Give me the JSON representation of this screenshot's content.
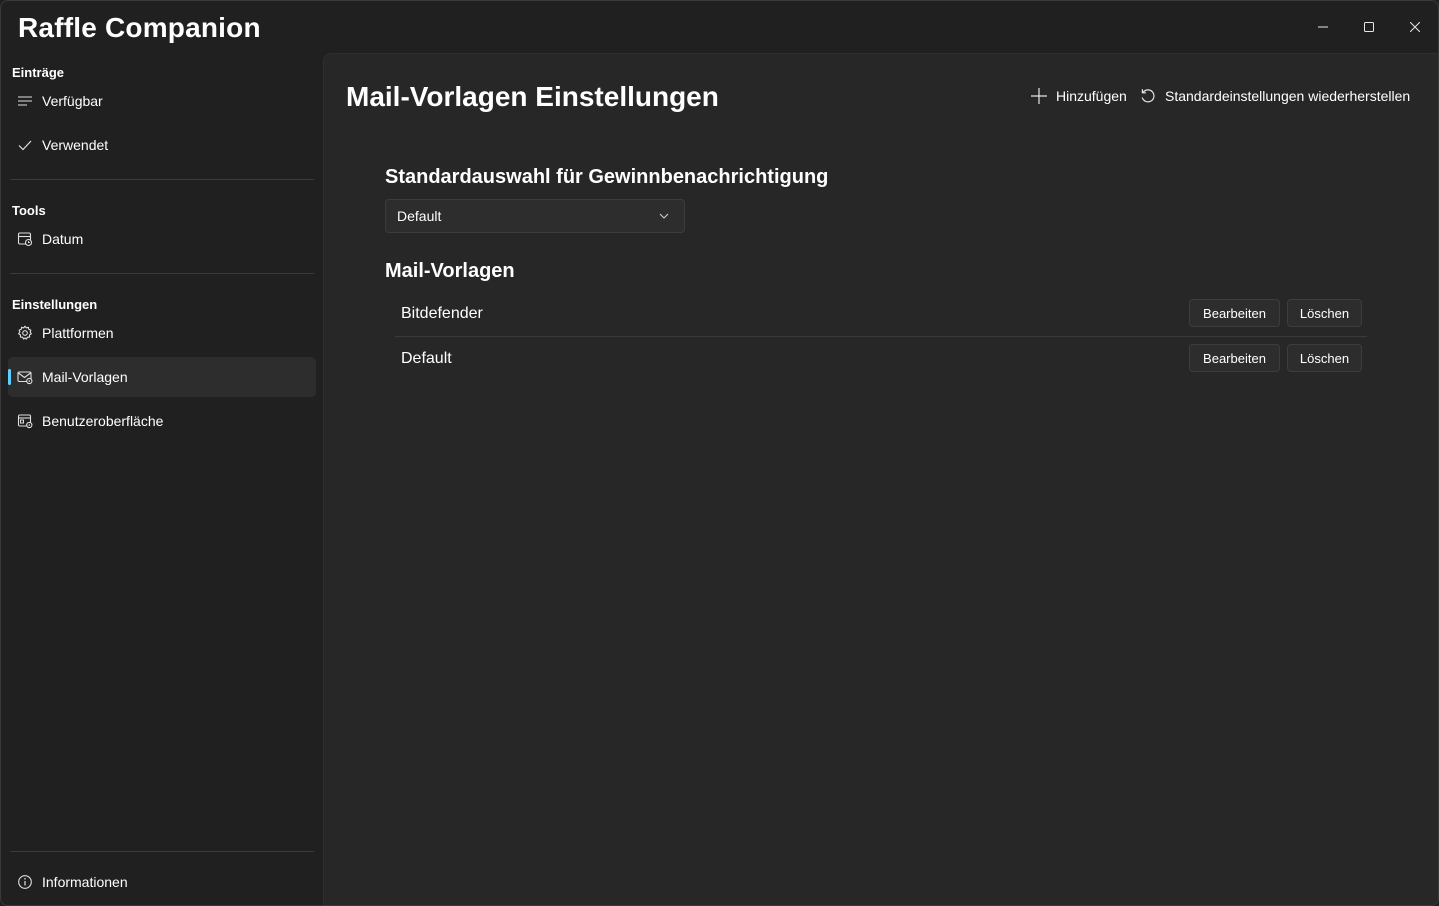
{
  "app": {
    "title": "Raffle Companion"
  },
  "sidebar": {
    "groups": [
      {
        "header": "Einträge",
        "items": [
          {
            "label": "Verfügbar",
            "icon": "list-icon"
          },
          {
            "label": "Verwendet",
            "icon": "check-icon"
          }
        ]
      },
      {
        "header": "Tools",
        "items": [
          {
            "label": "Datum",
            "icon": "calendar-icon"
          }
        ]
      },
      {
        "header": "Einstellungen",
        "items": [
          {
            "label": "Plattformen",
            "icon": "gear-icon"
          },
          {
            "label": "Mail-Vorlagen",
            "icon": "mail-settings-icon",
            "selected": true
          },
          {
            "label": "Benutzeroberfläche",
            "icon": "window-settings-icon"
          }
        ]
      }
    ],
    "footer": {
      "label": "Informationen",
      "icon": "info-icon"
    }
  },
  "page": {
    "title": "Mail-Vorlagen Einstellungen",
    "commands": {
      "add_label": "Hinzufügen",
      "reset_label": "Standardeinstellungen wiederherstellen"
    },
    "default_section": {
      "title": "Standardauswahl für Gewinnbenachrichtigung",
      "selected": "Default"
    },
    "templates_section": {
      "title": "Mail-Vorlagen",
      "items": [
        {
          "name": "Bitdefender",
          "edit_label": "Bearbeiten",
          "delete_label": "Löschen"
        },
        {
          "name": "Default",
          "edit_label": "Bearbeiten",
          "delete_label": "Löschen"
        }
      ]
    }
  },
  "colors": {
    "accent": "#60cdff",
    "background": "#202020",
    "content": "#272727"
  }
}
